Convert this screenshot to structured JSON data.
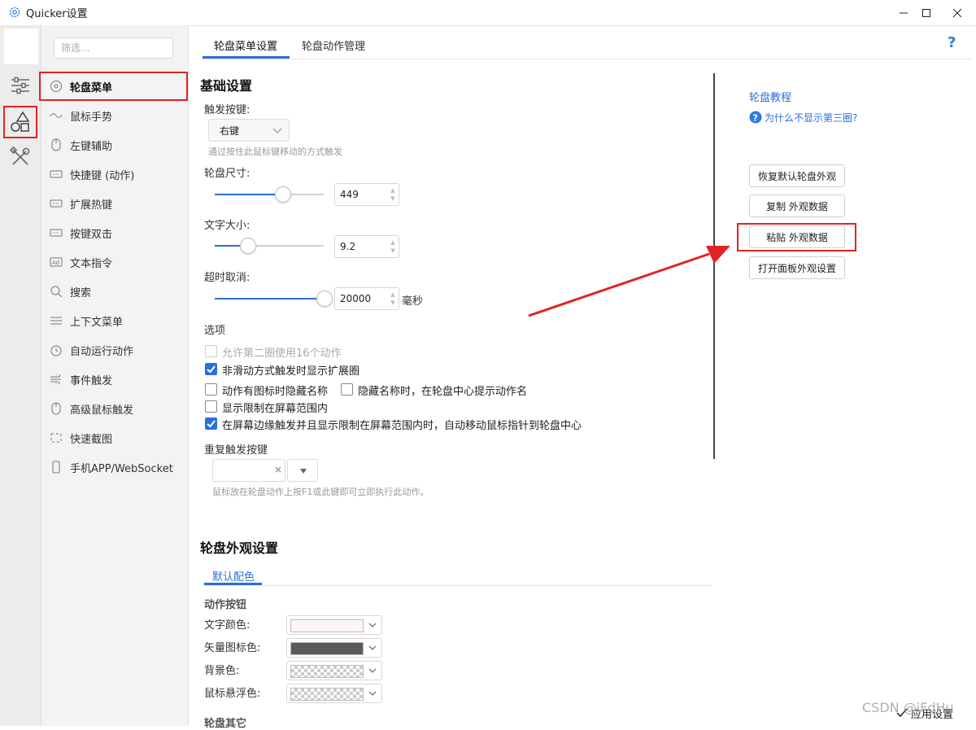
{
  "window": {
    "title": "Quicker设置"
  },
  "filter_placeholder": "筛选...",
  "nav": [
    {
      "label": "轮盘菜单"
    },
    {
      "label": "鼠标手势"
    },
    {
      "label": "左键辅助"
    },
    {
      "label": "快捷键 (动作)"
    },
    {
      "label": "扩展热键"
    },
    {
      "label": "按键双击"
    },
    {
      "label": "文本指令"
    },
    {
      "label": "搜索"
    },
    {
      "label": "上下文菜单"
    },
    {
      "label": "自动运行动作"
    },
    {
      "label": "事件触发"
    },
    {
      "label": "高级鼠标触发"
    },
    {
      "label": "快速截图"
    },
    {
      "label": "手机APP/WebSocket"
    }
  ],
  "tabs": [
    {
      "label": "轮盘菜单设置"
    },
    {
      "label": "轮盘动作管理"
    }
  ],
  "help": "?",
  "basic": {
    "title": "基础设置",
    "trigger_label": "触发按键:",
    "trigger_value": "右键",
    "trigger_hint": "通过按住此鼠标键移动的方式触发",
    "size_label": "轮盘尺寸:",
    "size_value": "449",
    "size_level": 0.62,
    "font_label": "文字大小:",
    "font_value": "9.2",
    "font_level": 0.3,
    "timeout_label": "超时取消:",
    "timeout_value": "20000",
    "timeout_level": 1.0,
    "timeout_unit": "毫秒",
    "options_title": "选项",
    "opt1": "允许第二圈使用16个动作",
    "opt2": "非滑动方式触发时显示扩展圈",
    "opt3": "动作有图标时隐藏名称",
    "opt4": "隐藏名称时，在轮盘中心提示动作名",
    "opt5": "显示限制在屏幕范围内",
    "opt6": "在屏幕边缘触发并且显示限制在屏幕范围内时，自动移动鼠标指针到轮盘中心",
    "repeat_label": "重复触发按键",
    "repeat_hint": "鼠标放在轮盘动作上按F1或此键即可立即执行此动作。"
  },
  "appearance": {
    "title": "轮盘外观设置",
    "subtab": "默认配色",
    "section": "动作按钮",
    "text_color_label": "文字颜色:",
    "vector_color_label": "矢量图标色:",
    "bg_color_label": "背景色:",
    "hover_color_label": "鼠标悬浮色:",
    "next_section": "轮盘其它"
  },
  "side": {
    "tutorial": "轮盘教程",
    "why": "为什么不显示第三圈?",
    "restore": "恢复默认轮盘外观",
    "copy": "复制 外观数据",
    "paste": "粘贴 外观数据",
    "open_panel": "打开面板外观设置"
  },
  "apply": "应用设置",
  "watermark": "CSDN @iFdHu",
  "colors": {
    "accent": "#2a6fdb",
    "highlight": "#e02424",
    "text_swatch": "#fdf5f5",
    "vector_swatch": "#5a5a5a"
  }
}
